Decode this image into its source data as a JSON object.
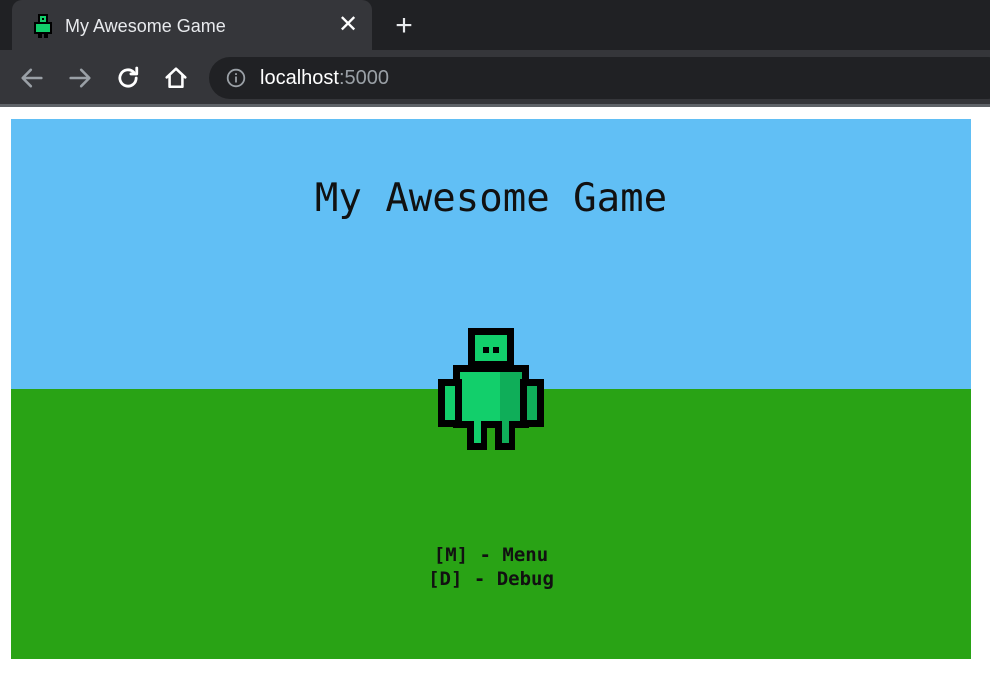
{
  "browser": {
    "tab": {
      "title": "My Awesome Game",
      "favicon": "robot-icon",
      "close_glyph": "✕"
    },
    "new_tab_glyph": "+",
    "address": {
      "host": "localhost",
      "port": ":5000"
    },
    "icons": {
      "back": "back-arrow-icon",
      "forward": "forward-arrow-icon",
      "reload": "reload-icon",
      "home": "home-icon",
      "info": "info-icon"
    },
    "colors": {
      "tab_strip": "#202124",
      "tab_active": "#35363a",
      "omnibox": "#202124"
    }
  },
  "game": {
    "title": "My Awesome Game",
    "controls": [
      "[M] - Menu",
      "[D] - Debug"
    ],
    "colors": {
      "sky": "#61bff5",
      "ground": "#29a315",
      "player_body": "#12cf6b",
      "player_shade": "#0fae59",
      "player_outline": "#000000"
    }
  }
}
